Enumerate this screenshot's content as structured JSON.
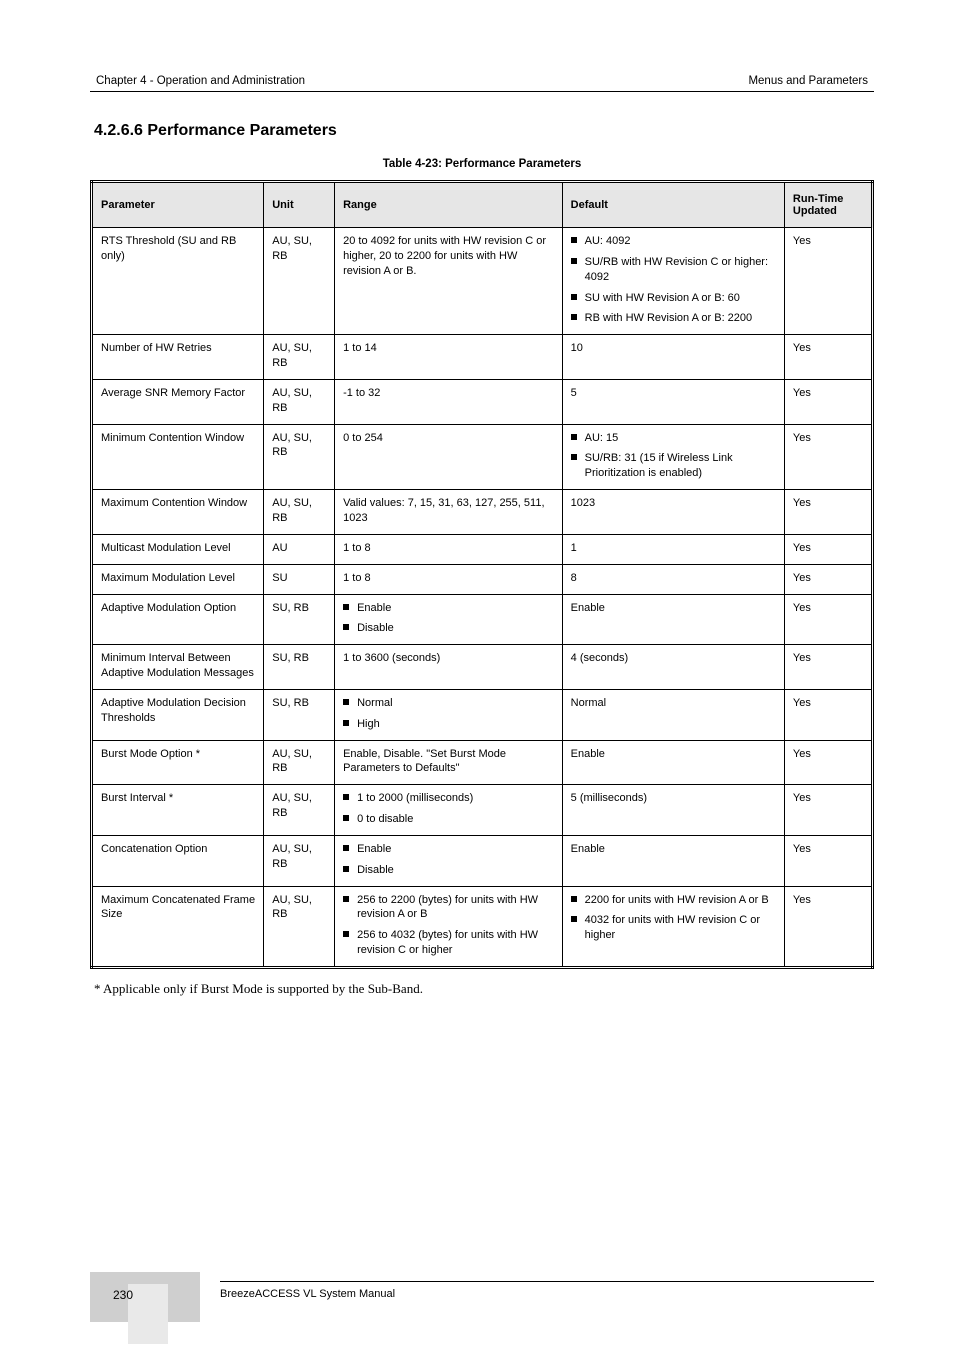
{
  "header": {
    "left": "Chapter 4 - Operation and Administration",
    "right": "Menus and Parameters"
  },
  "section_title": "4.2.6.6   Performance Parameters",
  "table_caption": "Table 4-23: Performance Parameters",
  "columns": [
    "Parameter",
    "Unit",
    "Range",
    "Default",
    "Run-Time Updated"
  ],
  "rows": [
    {
      "param": "RTS Threshold (SU and RB only)",
      "unit": "AU, SU, RB",
      "range": "20 to 4092 for units with HW revision C or higher, 20 to 2200 for units with HW revision A or B.",
      "default": [
        "AU: 4092",
        "SU/RB with HW Revision C or higher: 4092",
        "SU with HW Revision A or B: 60",
        "RB with HW Revision A or B: 2200"
      ],
      "rt": "Yes"
    },
    {
      "param": "Number of HW Retries",
      "unit": "AU, SU, RB",
      "range": "1 to 14",
      "default": "10",
      "rt": "Yes"
    },
    {
      "param": "Average SNR Memory Factor",
      "unit": "AU, SU, RB",
      "range": "-1 to 32",
      "default": "5",
      "rt": "Yes"
    },
    {
      "param": "Minimum Contention Window",
      "unit": "AU, SU, RB",
      "range": "0 to 254",
      "default": [
        "AU: 15",
        "SU/RB: 31 (15 if Wireless Link Prioritization is enabled)"
      ],
      "rt": "Yes"
    },
    {
      "param": "Maximum Contention Window",
      "unit": "AU, SU, RB",
      "range": "Valid values: 7, 15, 31, 63, 127, 255, 511, 1023",
      "default": "1023",
      "rt": "Yes"
    },
    {
      "param": "Multicast Modulation Level",
      "unit": "AU",
      "range": "1 to 8",
      "default": "1",
      "rt": "Yes"
    },
    {
      "param": "Maximum Modulation Level",
      "unit": "SU",
      "range": "1 to 8",
      "default": "8",
      "rt": "Yes"
    },
    {
      "param": "Adaptive Modulation Option",
      "unit": "SU, RB",
      "range": [
        "Enable",
        "Disable"
      ],
      "default": "Enable",
      "rt": "Yes"
    },
    {
      "param": "Minimum Interval Between Adaptive Modulation Messages",
      "unit": "SU, RB",
      "range": "1 to 3600 (seconds)",
      "default": "4 (seconds)",
      "rt": "Yes"
    },
    {
      "param": "Adaptive Modulation Decision Thresholds",
      "unit": "SU, RB",
      "range": [
        "Normal",
        "High"
      ],
      "default": "Normal",
      "rt": "Yes"
    },
    {
      "param": "Burst Mode Option *",
      "unit": "AU, SU, RB",
      "range": "Enable, Disable. \"Set Burst Mode Parameters to Defaults\"",
      "default": "Enable",
      "rt": "Yes"
    },
    {
      "param": "Burst Interval *",
      "unit": "AU, SU, RB",
      "range": [
        "1 to 2000 (milliseconds)",
        "0 to disable"
      ],
      "default": "5 (milliseconds)",
      "rt": "Yes"
    },
    {
      "param": "Concatenation Option",
      "unit": "AU, SU, RB",
      "range": [
        "Enable",
        "Disable"
      ],
      "default": "Enable",
      "rt": "Yes"
    },
    {
      "param": "Maximum Concatenated Frame Size",
      "unit": "AU, SU, RB",
      "range": [
        "256 to 2200 (bytes) for units with HW revision A or B",
        "256 to 4032 (bytes) for units with HW revision C or higher"
      ],
      "default": [
        "2200 for units with HW revision A or B",
        "4032 for units with HW revision C or higher"
      ],
      "rt": "Yes"
    }
  ],
  "footnote": "* Applicable only if Burst Mode is supported by the Sub-Band.",
  "footer": {
    "page": "230",
    "left": "BreezeACCESS VL System Manual",
    "right": ""
  }
}
